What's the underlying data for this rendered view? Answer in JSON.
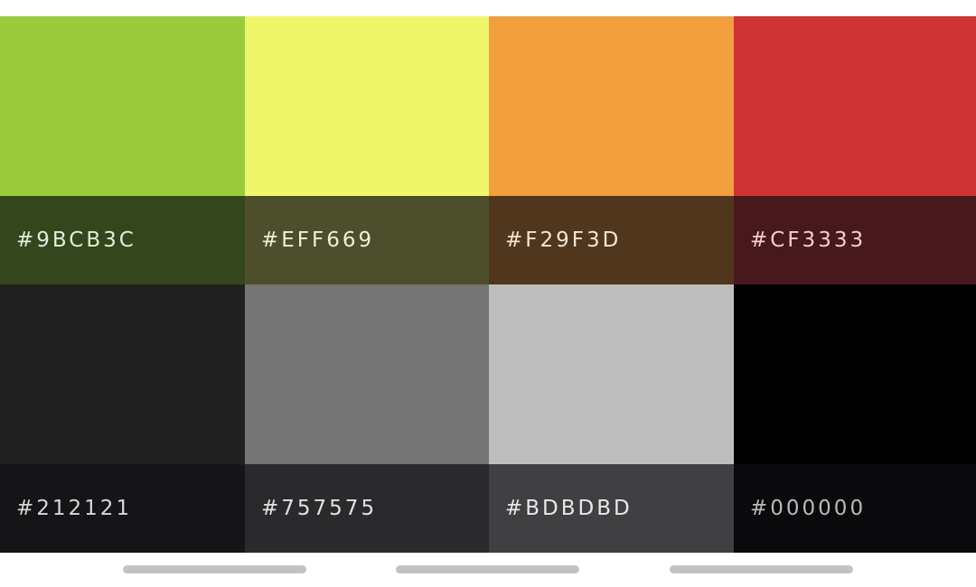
{
  "palette": {
    "swatches": [
      {
        "hex": "#9BCB3C",
        "color": "#9BCB3C",
        "label_bg": "#34461B",
        "label_color": "#E4EBD9"
      },
      {
        "hex": "#EFF669",
        "color": "#EFF669",
        "label_bg": "#4D4E2C",
        "label_color": "#EDEFD8"
      },
      {
        "hex": "#F29F3D",
        "color": "#F29F3D",
        "label_bg": "#50361D",
        "label_color": "#F4E4D4"
      },
      {
        "hex": "#CF3333",
        "color": "#CF3333",
        "label_bg": "#48191C",
        "label_color": "#F1CFD2"
      },
      {
        "hex": "#212121",
        "color": "#212121",
        "label_bg": "#151517",
        "label_color": "#D7D7D9"
      },
      {
        "hex": "#757575",
        "color": "#757575",
        "label_bg": "#2A2A2C",
        "label_color": "#E1E1E3"
      },
      {
        "hex": "#BDBDBD",
        "color": "#BDBDBD",
        "label_bg": "#404042",
        "label_color": "#E8E8EA"
      },
      {
        "hex": "#000000",
        "color": "#000000",
        "label_bg": "#0A0A0C",
        "label_color": "#B9B9BB"
      }
    ]
  },
  "scroll_indicator": {
    "color": "#C2C2C2"
  }
}
